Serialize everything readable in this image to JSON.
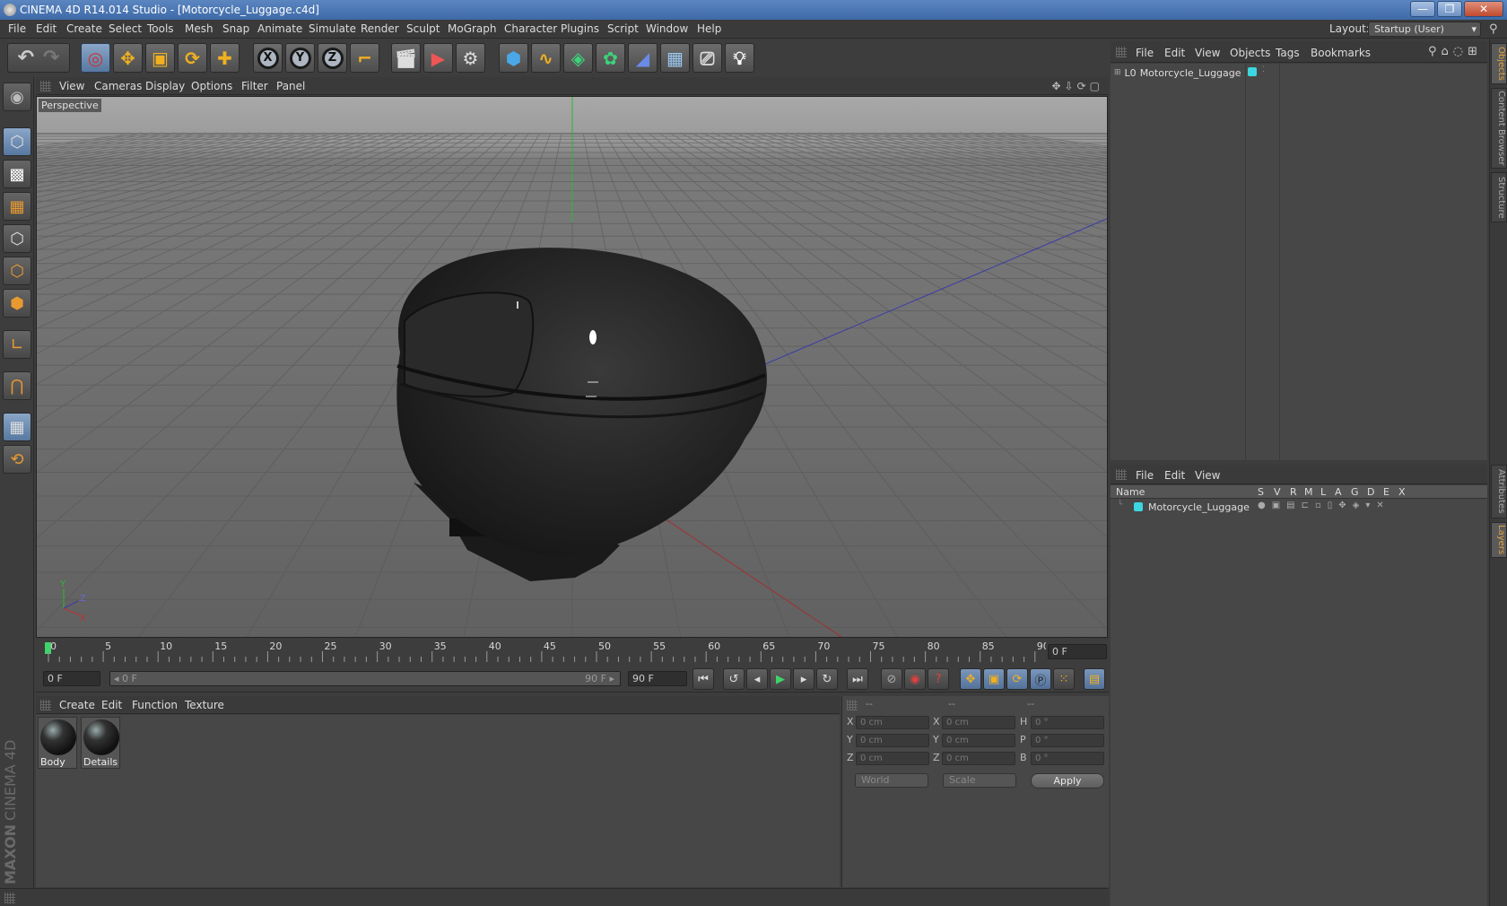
{
  "window": {
    "title": "CINEMA 4D R14.014 Studio - [Motorcycle_Luggage.c4d]",
    "buttons": [
      "—",
      "❐",
      "✕"
    ]
  },
  "menubar": {
    "items": [
      "File",
      "Edit",
      "Create",
      "Select",
      "Tools",
      "Mesh",
      "Snap",
      "Animate",
      "Simulate",
      "Render",
      "Sculpt",
      "MoGraph",
      "Character",
      "Plugins",
      "Script",
      "Window",
      "Help"
    ],
    "layout_label": "Layout:",
    "layout_value": "Startup (User)"
  },
  "toolbar": {
    "icons": [
      "undo-icon",
      "redo-icon",
      "live-selection-icon",
      "move-icon",
      "scale-icon",
      "rotate-icon",
      "add-object-icon",
      "x-axis-lock-icon",
      "y-axis-lock-icon",
      "z-axis-lock-icon",
      "coordinate-system-icon",
      "render-view-icon",
      "render-picture-viewer-icon",
      "edit-render-settings-icon",
      "cube-primitive-icon",
      "spline-icon",
      "nurbs-icon",
      "mograph-cloner-icon",
      "deformer-icon",
      "floor-scene-icon",
      "camera-icon",
      "light-icon"
    ],
    "axis_labels": [
      "X",
      "Y",
      "Z"
    ]
  },
  "lefttools": {
    "icons": [
      "make-editable-icon",
      "model-mode-icon",
      "texture-mode-icon",
      "workplane-icon",
      "points-mode-icon",
      "edges-mode-icon",
      "polygons-mode-icon",
      "axis-mode-icon",
      "magnet-icon",
      "snap-grid-icon",
      "locked-workplane-icon"
    ],
    "brand": "MAXON",
    "product": "CINEMA 4D"
  },
  "viewport": {
    "menu": [
      "View",
      "Cameras",
      "Display",
      "Options",
      "Filter",
      "Panel"
    ],
    "label": "Perspective",
    "axis_labels": {
      "x": "X",
      "y": "Y",
      "z": "Z"
    }
  },
  "timeline": {
    "ticks": [
      "0",
      "5",
      "10",
      "15",
      "20",
      "25",
      "30",
      "35",
      "40",
      "45",
      "50",
      "55",
      "60",
      "65",
      "70",
      "75",
      "80",
      "85",
      "90"
    ],
    "current_frame": "0 F"
  },
  "playbar": {
    "start": "0 F",
    "slider_left": "◂ 0 F",
    "slider_right": "90 F ▸",
    "end": "90 F"
  },
  "materials": {
    "menu": [
      "Create",
      "Edit",
      "Function",
      "Texture"
    ],
    "items": [
      "Body",
      "Details"
    ]
  },
  "coords": {
    "headers": [
      "--",
      "--",
      "--"
    ],
    "rows": [
      {
        "l1": "X",
        "v1": "0 cm",
        "l2": "X",
        "v2": "0 cm",
        "l3": "H",
        "v3": "0 °"
      },
      {
        "l1": "Y",
        "v1": "0 cm",
        "l2": "Y",
        "v2": "0 cm",
        "l3": "P",
        "v3": "0 °"
      },
      {
        "l1": "Z",
        "v1": "0 cm",
        "l2": "Z",
        "v2": "0 cm",
        "l3": "B",
        "v3": "0 °"
      }
    ],
    "space": "World",
    "mode": "Scale",
    "apply": "Apply"
  },
  "objects": {
    "menu": [
      "File",
      "Edit",
      "View",
      "Objects",
      "Tags",
      "Bookmarks"
    ],
    "item": "Motorcycle_Luggage",
    "item_color": "#3bd6e0"
  },
  "layers": {
    "menu": [
      "File",
      "Edit",
      "View"
    ],
    "columns": [
      "Name",
      "S",
      "V",
      "R",
      "M",
      "L",
      "A",
      "G",
      "D",
      "E",
      "X"
    ],
    "item": "Motorcycle_Luggage"
  },
  "sidetabs": [
    "Objects",
    "Content Browser",
    "Structure",
    "Attributes",
    "Layers"
  ]
}
